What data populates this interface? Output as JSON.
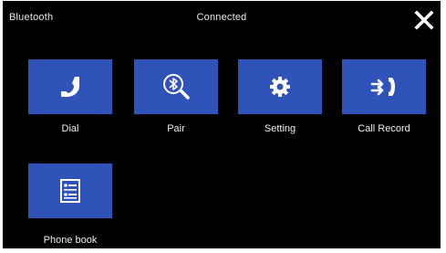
{
  "header": {
    "app_title": "Bluetooth",
    "status": "Connected",
    "close_icon": "close-icon"
  },
  "tiles": [
    {
      "label": "Dial",
      "icon": "phone-handset-icon"
    },
    {
      "label": "Pair",
      "icon": "bluetooth-search-icon"
    },
    {
      "label": "Setting",
      "icon": "gear-icon"
    },
    {
      "label": "Call Record",
      "icon": "call-record-icon"
    },
    {
      "label": "Phone book",
      "icon": "contacts-list-icon"
    }
  ],
  "colors": {
    "background": "#000000",
    "tile": "#2f53b8",
    "text": "#ffffff"
  }
}
